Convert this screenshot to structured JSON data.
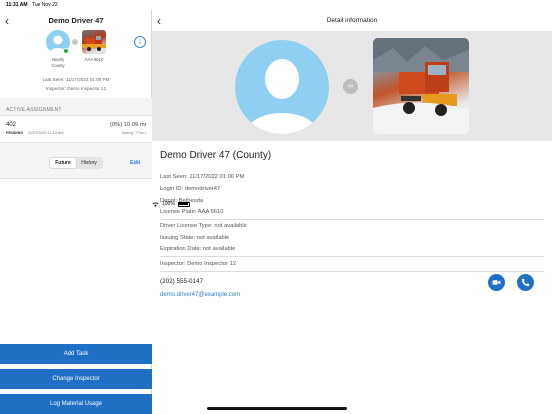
{
  "status_bar": {
    "time": "11:31 AM",
    "date": "Tue Nov 22",
    "battery": "100%"
  },
  "left": {
    "title": "Demo Driver 47",
    "avatar_caption_line1": "Nearly",
    "avatar_caption_line2": "County",
    "truck_caption": "AAA 6610",
    "last_seen": "Last Seen: 11/17/2022 01:00 PM",
    "inspector": "Inspector: Demo Inspector 12",
    "active_assignment_label": "ACTIVE ASSIGNMENT",
    "assignment": {
      "number": "402",
      "status": "PENDING",
      "date": "11/21/2022 11:53 AM",
      "progress": "(0%) 10.09 mi",
      "mode": "Salting / Plan I"
    },
    "tabs": [
      "Future",
      "History"
    ],
    "edit_label": "Edit",
    "buttons": {
      "add_task": "Add Task",
      "change_inspector": "Change Inspector",
      "log_material": "Log Material Usage"
    }
  },
  "right": {
    "title": "Detail information",
    "name": "Demo Driver 47 (County)",
    "last_seen": "Last Seen: 11/17/2022 01:00 PM",
    "login_id": "Login ID: demodriver47",
    "depot": "Depot: Bethesda",
    "license_plate": "License Plate: AAA 6610",
    "license_type": "Driver License Type: not available",
    "issuing_state": "Issuing State: not available",
    "expiration": "Expiration Date: not available",
    "inspector": "Inspector: Demo Inspector 12",
    "phone": "(202) 555-0147",
    "email": "demo.driver47@example.com"
  },
  "colors": {
    "accent": "#1f6fc5",
    "link": "#2f7fd4",
    "online": "#2ea84c",
    "avatar_bg": "#8fd0f2"
  },
  "icons": [
    "back-chevron-icon",
    "info-icon",
    "link-icon",
    "video-icon",
    "phone-icon",
    "wifi-icon",
    "battery-icon"
  ]
}
